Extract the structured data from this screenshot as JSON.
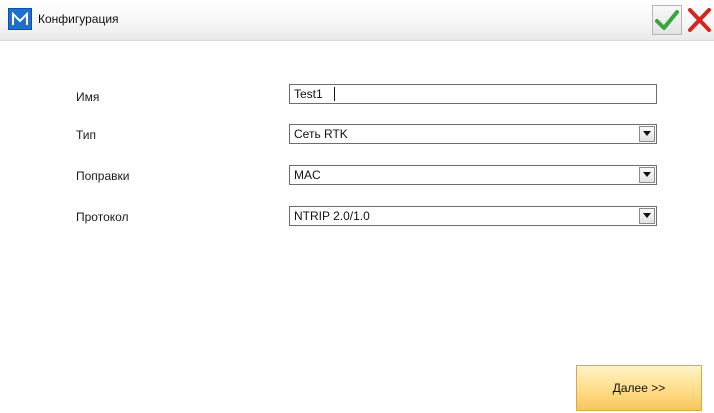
{
  "window": {
    "title": "Конфигурация",
    "logo_letter": "M",
    "ok_icon": "checkmark-icon",
    "cancel_icon": "close-icon"
  },
  "form": {
    "name_label": "Имя",
    "name_value": "Test1",
    "type_label": "Тип",
    "type_value": "Сеть RTK",
    "corrections_label": "Поправки",
    "corrections_value": "MAC",
    "protocol_label": "Протокол",
    "protocol_value": "NTRIP 2.0/1.0"
  },
  "footer": {
    "next_label": "Далее >>"
  },
  "colors": {
    "accent": "#1f6fd1",
    "ok_green": "#3aa53a",
    "cancel_red": "#d3261f",
    "next_button": "#ffdf8e"
  }
}
